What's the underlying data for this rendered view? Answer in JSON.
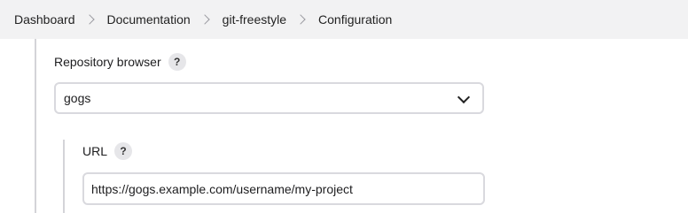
{
  "breadcrumb": {
    "items": [
      {
        "label": "Dashboard"
      },
      {
        "label": "Documentation"
      },
      {
        "label": "git-freestyle"
      },
      {
        "label": "Configuration"
      }
    ]
  },
  "form": {
    "repository_browser": {
      "label": "Repository browser",
      "help": "?",
      "selected": "gogs",
      "expand_icon": "chevron-down-icon"
    },
    "url": {
      "label": "URL",
      "help": "?",
      "value": "https://gogs.example.com/username/my-project"
    }
  }
}
